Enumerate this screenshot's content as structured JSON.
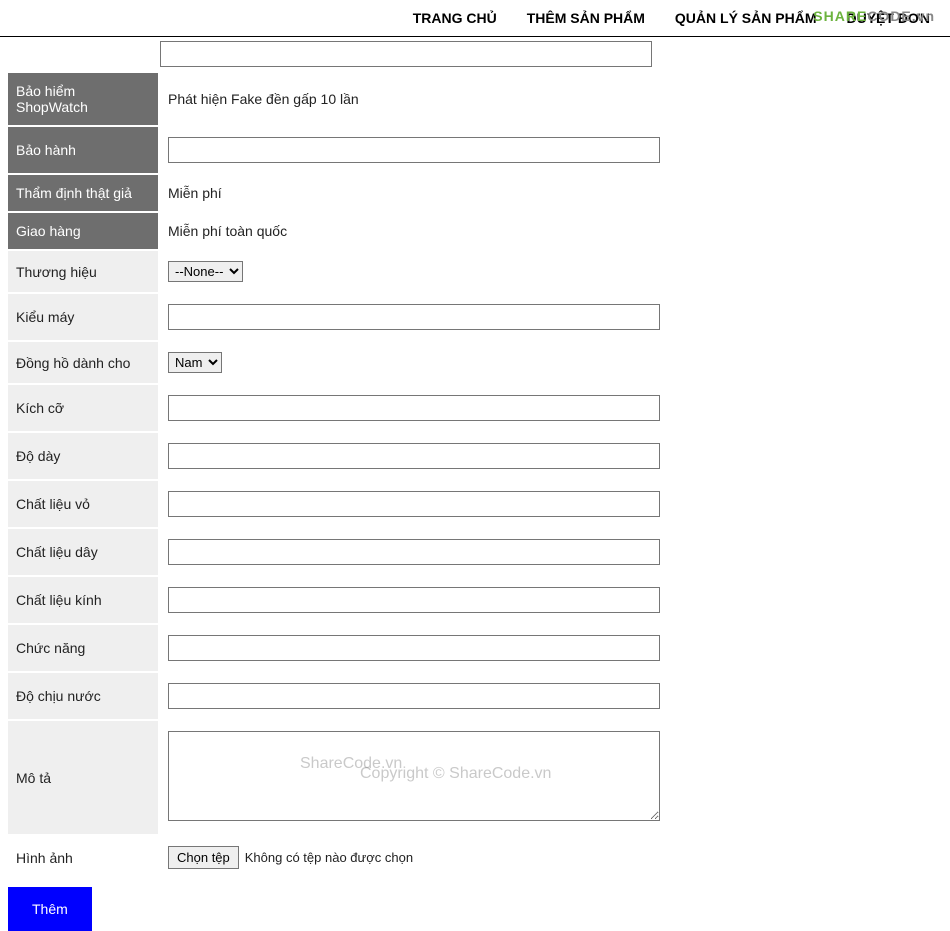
{
  "nav": {
    "items": [
      {
        "label": "TRANG CHỦ"
      },
      {
        "label": "THÊM SẢN PHẨM"
      },
      {
        "label": "QUẢN LÝ SẢN PHẨM"
      },
      {
        "label": "DUYỆT ĐƠN"
      }
    ]
  },
  "logo": {
    "text1": "SHARE",
    "text2": "CODE",
    "suffix": ".vn"
  },
  "form": {
    "baohiem": {
      "label": "Bảo hiểm ShopWatch",
      "value": "Phát hiện Fake đền gấp 10 lần"
    },
    "baohanh": {
      "label": "Bảo hành",
      "value": ""
    },
    "thamdinh": {
      "label": "Thẩm định thật giả",
      "value": "Miễn phí"
    },
    "giaohang": {
      "label": "Giao hàng",
      "value": "Miễn phí toàn quốc"
    },
    "thuonghieu": {
      "label": "Thương hiệu",
      "selected": "--None--"
    },
    "kieumay": {
      "label": "Kiểu máy",
      "value": ""
    },
    "danhcho": {
      "label": "Đồng hồ dành cho",
      "selected": "Nam"
    },
    "kichco": {
      "label": "Kích cỡ",
      "value": ""
    },
    "doday": {
      "label": "Độ dày",
      "value": ""
    },
    "chatlieuvo": {
      "label": "Chất liệu vỏ",
      "value": ""
    },
    "chatlieuday": {
      "label": "Chất liệu dây",
      "value": ""
    },
    "chatlieukinh": {
      "label": "Chất liệu kính",
      "value": ""
    },
    "chucnang": {
      "label": "Chức năng",
      "value": ""
    },
    "dochiunuoc": {
      "label": "Độ chịu nước",
      "value": ""
    },
    "mota": {
      "label": "Mô tả",
      "value": ""
    },
    "hinhanh": {
      "label": "Hình ảnh",
      "button": "Chọn tệp",
      "status": "Không có tệp nào được chọn"
    },
    "submit": "Thêm"
  },
  "watermark": {
    "line1": "ShareCode.vn",
    "line2": "Copyright © ShareCode.vn"
  }
}
